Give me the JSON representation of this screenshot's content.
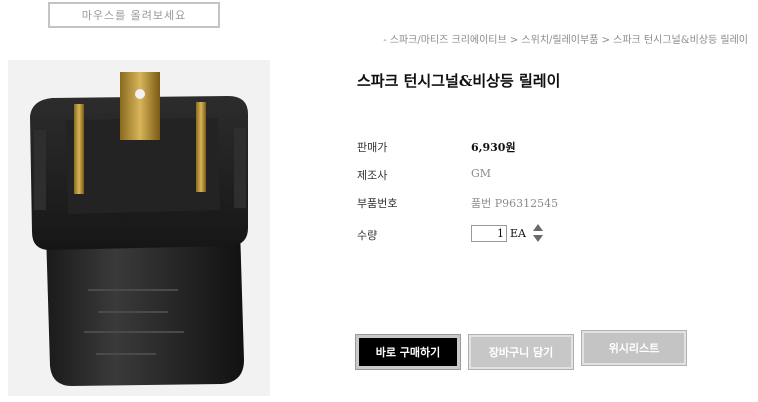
{
  "zoom_hint": "마우스를 올려보세요",
  "breadcrumb": "- 스파크/마티즈 크리에이티브 > 스위치/릴레이부품 > 스파크 턴시그널&비상등 릴레이",
  "product": {
    "title": "스파크 턴시그널&비상등 릴레이",
    "image_alt": "relay-product-photo"
  },
  "specs": {
    "price_label": "판매가",
    "price_value": "6,930원",
    "maker_label": "제조사",
    "maker_value": "GM",
    "part_label": "부품번호",
    "part_value": "품번 P96312545",
    "qty_label": "수량",
    "qty_value": "1",
    "qty_unit": "EA"
  },
  "buttons": {
    "buy": "바로 구매하기",
    "cart": "장바구니 담기",
    "wishlist": "위시리스트"
  },
  "colors": {
    "buy_bg": "#000000",
    "secondary_btn_bg": "#c7c7c7"
  }
}
